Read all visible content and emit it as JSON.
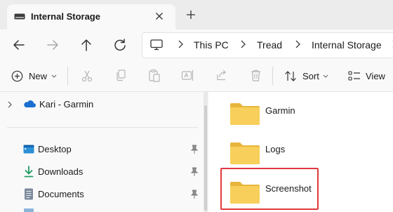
{
  "tab": {
    "title": "Internal Storage"
  },
  "breadcrumbs": [
    "This PC",
    "Tread",
    "Internal Storage"
  ],
  "command_bar": {
    "new_label": "New",
    "sort_label": "Sort",
    "view_label": "View"
  },
  "nav_pane": {
    "top_item": "Kari - Garmin",
    "quick_access": [
      {
        "label": "Desktop",
        "icon": "desktop-icon"
      },
      {
        "label": "Downloads",
        "icon": "download-icon"
      },
      {
        "label": "Documents",
        "icon": "documents-icon"
      }
    ]
  },
  "folders": [
    {
      "name": "Garmin"
    },
    {
      "name": "Logs"
    },
    {
      "name": "Screenshot",
      "highlighted": true
    }
  ],
  "colors": {
    "highlight_border": "#e0393e",
    "folder": "#f8cf5a",
    "onedrive": "#1a6fd1"
  }
}
